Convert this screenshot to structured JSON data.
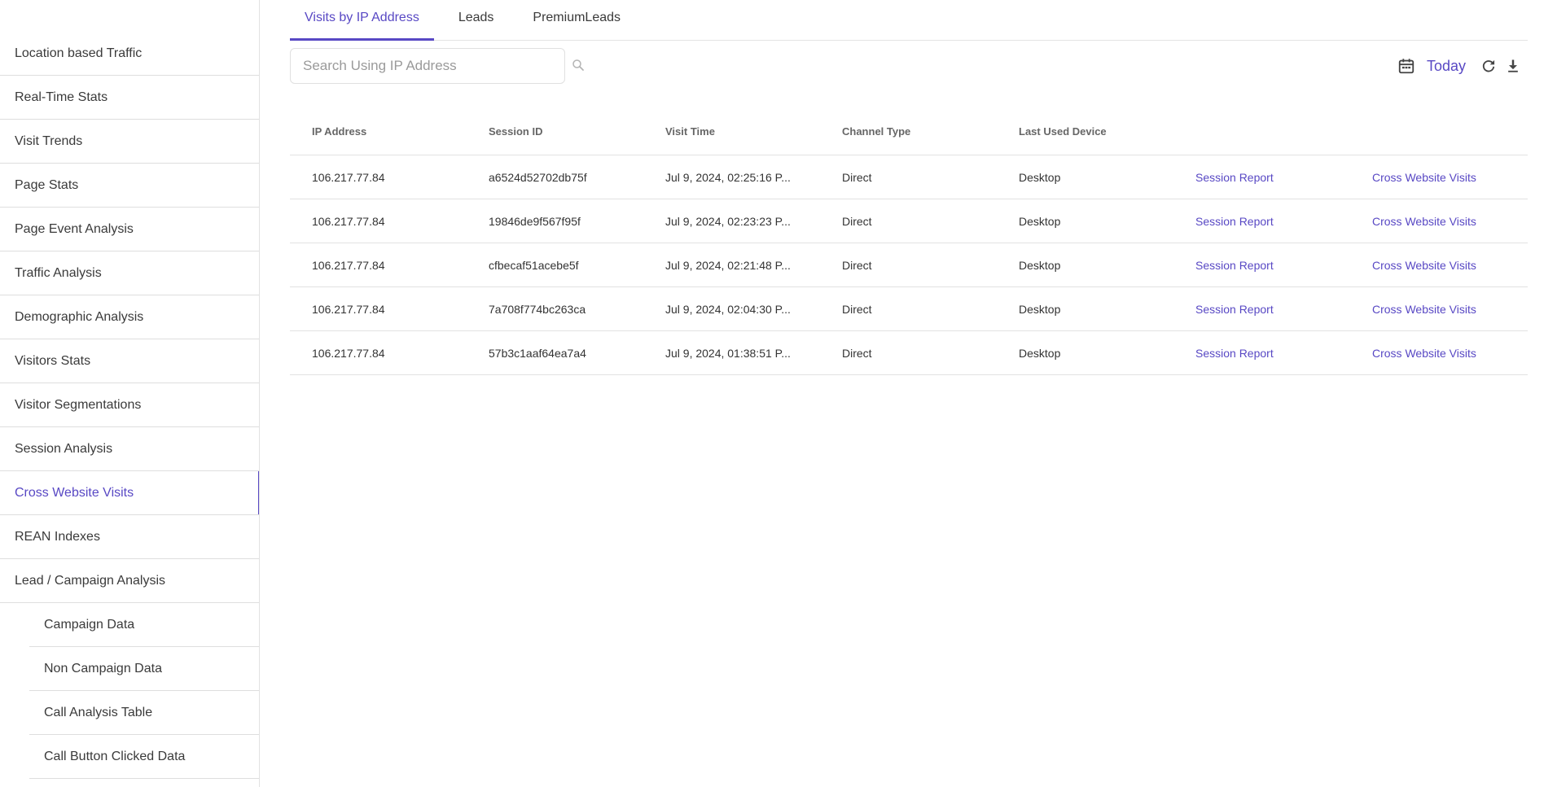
{
  "sidebar": {
    "items": [
      {
        "label": "Location based Traffic"
      },
      {
        "label": "Real-Time Stats"
      },
      {
        "label": "Visit Trends"
      },
      {
        "label": "Page Stats"
      },
      {
        "label": "Page Event Analysis"
      },
      {
        "label": "Traffic Analysis"
      },
      {
        "label": "Demographic Analysis"
      },
      {
        "label": "Visitors Stats"
      },
      {
        "label": "Visitor Segmentations"
      },
      {
        "label": "Session Analysis"
      },
      {
        "label": "Cross Website Visits",
        "active": true
      },
      {
        "label": "REAN Indexes"
      },
      {
        "label": "Lead / Campaign Analysis"
      }
    ],
    "sub_items": [
      {
        "label": "Campaign Data"
      },
      {
        "label": "Non Campaign Data"
      },
      {
        "label": "Call Analysis Table"
      },
      {
        "label": "Call Button Clicked Data"
      }
    ]
  },
  "tabs": [
    {
      "label": "Visits by IP Address",
      "active": true
    },
    {
      "label": "Leads"
    },
    {
      "label": "PremiumLeads"
    }
  ],
  "search": {
    "placeholder": "Search Using IP Address",
    "value": ""
  },
  "date_range": {
    "label": "Today"
  },
  "table": {
    "headers": [
      "IP Address",
      "Session ID",
      "Visit Time",
      "Channel Type",
      "Last Used Device"
    ],
    "rows": [
      {
        "ip": "106.217.77.84",
        "session_id": "a6524d52702db75f",
        "visit_time": "Jul 9, 2024, 02:25:16 P...",
        "channel": "Direct",
        "device": "Desktop",
        "session_report": "Session Report",
        "cross_visits": "Cross Website Visits"
      },
      {
        "ip": "106.217.77.84",
        "session_id": "19846de9f567f95f",
        "visit_time": "Jul 9, 2024, 02:23:23 P...",
        "channel": "Direct",
        "device": "Desktop",
        "session_report": "Session Report",
        "cross_visits": "Cross Website Visits"
      },
      {
        "ip": "106.217.77.84",
        "session_id": "cfbecaf51acebe5f",
        "visit_time": "Jul 9, 2024, 02:21:48 P...",
        "channel": "Direct",
        "device": "Desktop",
        "session_report": "Session Report",
        "cross_visits": "Cross Website Visits"
      },
      {
        "ip": "106.217.77.84",
        "session_id": "7a708f774bc263ca",
        "visit_time": "Jul 9, 2024, 02:04:30 P...",
        "channel": "Direct",
        "device": "Desktop",
        "session_report": "Session Report",
        "cross_visits": "Cross Website Visits"
      },
      {
        "ip": "106.217.77.84",
        "session_id": "57b3c1aaf64ea7a4",
        "visit_time": "Jul 9, 2024, 01:38:51 P...",
        "channel": "Direct",
        "device": "Desktop",
        "session_report": "Session Report",
        "cross_visits": "Cross Website Visits"
      }
    ]
  },
  "colors": {
    "accent": "#5848c4",
    "border": "#e2e2e2",
    "text": "#333333"
  },
  "icons": {
    "search": "search-icon",
    "calendar": "calendar-icon",
    "refresh": "refresh-icon",
    "download": "download-icon"
  }
}
